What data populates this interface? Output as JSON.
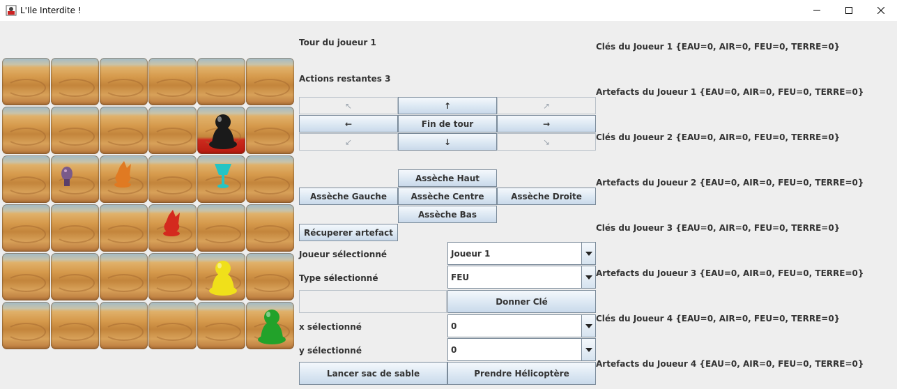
{
  "window": {
    "title": "L'Ile Interdite !",
    "controls": {
      "minimize": "minimize-icon",
      "maximize": "maximize-icon",
      "close": "close-icon"
    }
  },
  "status": {
    "turn_label": "Tour du joueur 1",
    "actions_label": "Actions restantes 3"
  },
  "board": {
    "rows": 6,
    "cols": 6,
    "red_tiles": [
      [
        1,
        4
      ]
    ],
    "pieces": [
      {
        "name": "black-pawn",
        "row": 1,
        "col": 4,
        "color": "#1a1a1a"
      },
      {
        "name": "yellow-pawn",
        "row": 4,
        "col": 4,
        "color": "#f0e01a"
      },
      {
        "name": "green-pawn",
        "row": 5,
        "col": 5,
        "color": "#22a22a"
      },
      {
        "name": "earth-stone-artifact",
        "row": 2,
        "col": 1,
        "color": "#7a5a8a"
      },
      {
        "name": "fire-crystal-artifact",
        "row": 2,
        "col": 2,
        "color": "#e07a22"
      },
      {
        "name": "ocean-chalice-artifact",
        "row": 2,
        "col": 4,
        "color": "#25c4c4"
      },
      {
        "name": "wind-statue-artifact",
        "row": 3,
        "col": 3,
        "color": "#d42a1e"
      }
    ]
  },
  "move_buttons": {
    "up_left": "↖",
    "up": "↑",
    "up_right": "↗",
    "left": "←",
    "end_turn": "Fin de tour",
    "right": "→",
    "down_left": "↙",
    "down": "↓",
    "down_right": "↘"
  },
  "dry_buttons": {
    "top": "Assèche Haut",
    "left": "Assèche Gauche",
    "center": "Assèche Centre",
    "right": "Assèche Droite",
    "bottom": "Assèche Bas"
  },
  "actions": {
    "recover_artifact": "Récuperer artefact",
    "give_key": "Donner Clé",
    "sandbag": "Lancer sac de sable",
    "helicopter": "Prendre Hélicoptère"
  },
  "selectors": {
    "player": {
      "label": "Joueur sélectionné",
      "value": "Joueur 1"
    },
    "type": {
      "label": "Type sélectionné",
      "value": "FEU"
    },
    "x": {
      "label": "x sélectionné",
      "value": "0"
    },
    "y": {
      "label": "y sélectionné",
      "value": "0"
    }
  },
  "players_info": [
    {
      "keys": "Clés du Joueur 1 {EAU=0, AIR=0, FEU=0, TERRE=0}",
      "artifacts": "Artefacts du Joueur 1 {EAU=0, AIR=0, FEU=0, TERRE=0}"
    },
    {
      "keys": "Clés du Joueur 2 {EAU=0, AIR=0, FEU=0, TERRE=0}",
      "artifacts": "Artefacts du Joueur 2 {EAU=0, AIR=0, FEU=0, TERRE=0}"
    },
    {
      "keys": "Clés du Joueur 3 {EAU=0, AIR=0, FEU=0, TERRE=0}",
      "artifacts": "Artefacts du Joueur 3 {EAU=0, AIR=0, FEU=0, TERRE=0}"
    },
    {
      "keys": "Clés du Joueur 4 {EAU=0, AIR=0, FEU=0, TERRE=0}",
      "artifacts": "Artefacts du Joueur 4 {EAU=0, AIR=0, FEU=0, TERRE=0}"
    }
  ]
}
